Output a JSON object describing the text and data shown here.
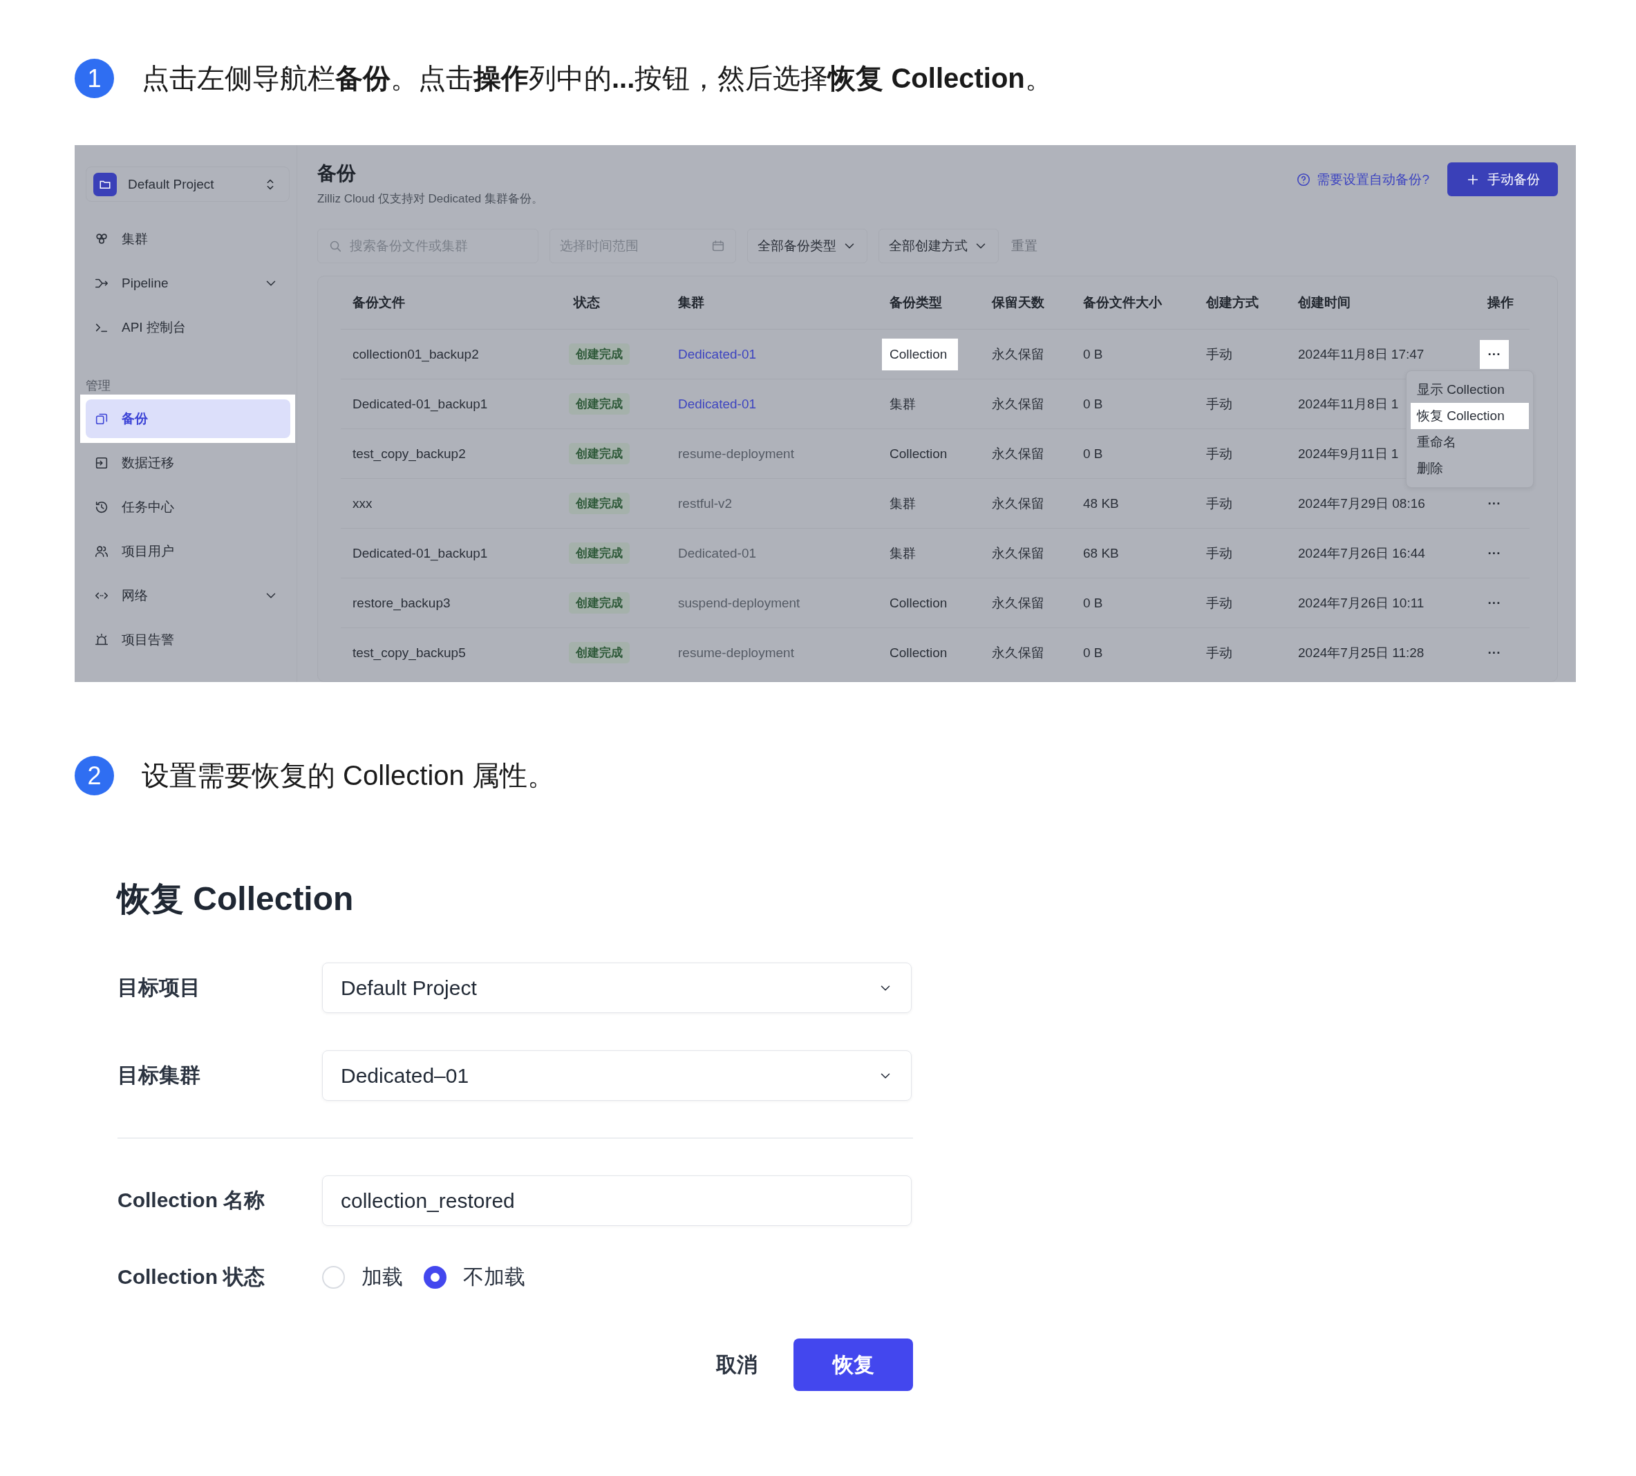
{
  "steps": [
    {
      "number": "1",
      "text": "点击左侧导航栏**备份**。点击**操作**列中的**...**按钮，然后选择**恢复 Collection**。"
    },
    {
      "number": "2",
      "text": "设置需要恢复的 Collection 属性。"
    }
  ],
  "screenshot": {
    "sidebar": {
      "project": "Default Project",
      "sections": [
        {
          "items": [
            {
              "label": "集群",
              "kind": "link",
              "selected": false,
              "highlighted": false
            },
            {
              "label": "Pipeline",
              "kind": "group",
              "selected": false,
              "highlighted": false
            },
            {
              "label": "API 控制台",
              "kind": "link",
              "selected": false,
              "highlighted": false
            }
          ]
        },
        {
          "title": "管理",
          "items": [
            {
              "label": "备份",
              "kind": "link",
              "selected": true,
              "highlighted": true
            },
            {
              "label": "数据迁移",
              "kind": "link",
              "selected": false,
              "highlighted": false
            },
            {
              "label": "任务中心",
              "kind": "link",
              "selected": false,
              "highlighted": false
            },
            {
              "label": "项目用户",
              "kind": "link",
              "selected": false,
              "highlighted": false
            },
            {
              "label": "网络",
              "kind": "group",
              "selected": false,
              "highlighted": false
            },
            {
              "label": "项目告警",
              "kind": "link",
              "selected": false,
              "highlighted": false
            }
          ]
        }
      ]
    },
    "header": {
      "title": "备份",
      "subtitle": "Zilliz Cloud 仅支持对 Dedicated 集群备份。",
      "help_link": "需要设置自动备份?",
      "button": "手动备份"
    },
    "filters": {
      "search_placeholder": "搜索备份文件或集群",
      "date_placeholder": "选择时间范围",
      "dropdowns": [
        "全部备份类型",
        "全部创建方式"
      ],
      "reset": "重置"
    },
    "table": {
      "columns": [
        "备份文件",
        "状态",
        "集群",
        "备份类型",
        "保留天数",
        "备份文件大小",
        "创建方式",
        "创建时间",
        "操作"
      ],
      "rows": [
        {
          "file": "collection01_backup2",
          "status": "创建完成",
          "cluster": "Dedicated-01",
          "linked": true,
          "type": "Collection",
          "retention": "永久保留",
          "size": "0 B",
          "method": "手动",
          "time": "2024年11月8日 17:47",
          "actions": "···",
          "highlighted": true
        },
        {
          "file": "Dedicated-01_backup1",
          "status": "创建完成",
          "cluster": "Dedicated-01",
          "linked": true,
          "type": "集群",
          "retention": "永久保留",
          "size": "0 B",
          "method": "手动",
          "time": "2024年11月8日 1",
          "highlighted": false
        },
        {
          "file": "test_copy_backup2",
          "status": "创建完成",
          "cluster": "resume-deployment",
          "linked": false,
          "type": "Collection",
          "retention": "永久保留",
          "size": "0 B",
          "method": "手动",
          "time": "2024年9月11日 1",
          "highlighted": false
        },
        {
          "file": "xxx",
          "status": "创建完成",
          "cluster": "restful-v2",
          "linked": false,
          "type": "集群",
          "retention": "永久保留",
          "size": "48 KB",
          "method": "手动",
          "time": "2024年7月29日 08:16",
          "actions": "···",
          "highlighted": false
        },
        {
          "file": "Dedicated-01_backup1",
          "status": "创建完成",
          "cluster": "Dedicated-01",
          "linked": false,
          "type": "集群",
          "retention": "永久保留",
          "size": "68 KB",
          "method": "手动",
          "time": "2024年7月26日 16:44",
          "actions": "···",
          "highlighted": false
        },
        {
          "file": "restore_backup3",
          "status": "创建完成",
          "cluster": "suspend-deployment",
          "linked": false,
          "type": "Collection",
          "retention": "永久保留",
          "size": "0 B",
          "method": "手动",
          "time": "2024年7月26日 10:11",
          "actions": "···",
          "highlighted": false
        },
        {
          "file": "test_copy_backup5",
          "status": "创建完成",
          "cluster": "resume-deployment",
          "linked": false,
          "type": "Collection",
          "retention": "永久保留",
          "size": "0 B",
          "method": "手动",
          "time": "2024年7月25日 11:28",
          "actions": "···",
          "highlighted": false
        }
      ]
    },
    "menu": {
      "items": [
        {
          "label": "显示 Collection",
          "selected": false
        },
        {
          "label": "恢复 Collection",
          "selected": true
        },
        {
          "label": "重命名",
          "selected": false
        },
        {
          "label": "删除",
          "selected": false
        }
      ]
    }
  },
  "dialog": {
    "title": "恢复 Collection",
    "target_fields": [
      {
        "label": "目标项目",
        "kind": "select",
        "value": "Default Project"
      },
      {
        "label": "目标集群",
        "kind": "select",
        "value": "Dedicated–01"
      }
    ],
    "collection_fields": [
      {
        "label": "Collection 名称",
        "kind": "input",
        "value": "collection_restored"
      },
      {
        "label": "Collection 状态",
        "kind": "radio",
        "options": [
          {
            "label": "加载",
            "selected": false
          },
          {
            "label": "不加载",
            "selected": true
          }
        ]
      }
    ],
    "buttons": [
      {
        "label": "取消",
        "kind": "text"
      },
      {
        "label": "恢复",
        "kind": "primary"
      }
    ]
  }
}
